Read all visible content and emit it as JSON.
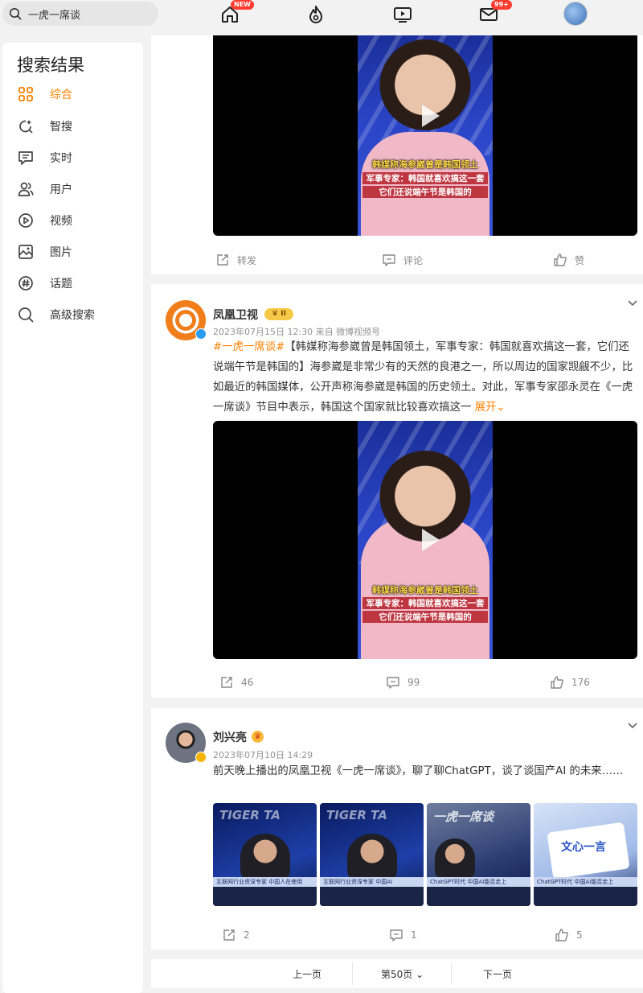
{
  "search": {
    "query": "一虎一席谈"
  },
  "topnav": {
    "items": [
      {
        "name": "home",
        "badge": "NEW"
      },
      {
        "name": "hot",
        "badge": ""
      },
      {
        "name": "video",
        "badge": ""
      },
      {
        "name": "message",
        "badge": "99+"
      }
    ]
  },
  "sidebar": {
    "title": "搜索结果",
    "items": [
      {
        "label": "综合",
        "icon": "grid-icon",
        "active": true
      },
      {
        "label": "智搜",
        "icon": "smart-search-icon"
      },
      {
        "label": "实时",
        "icon": "realtime-icon"
      },
      {
        "label": "用户",
        "icon": "users-icon"
      },
      {
        "label": "视频",
        "icon": "video-icon"
      },
      {
        "label": "图片",
        "icon": "image-icon"
      },
      {
        "label": "话题",
        "icon": "topic-icon"
      },
      {
        "label": "高级搜索",
        "icon": "advanced-search-icon"
      }
    ]
  },
  "video": {
    "caption_title": "韩媒称海参崴曾是韩国领土",
    "caption_line1": "军事专家：韩国就喜欢搞这一套",
    "caption_line2": "它们还说端午节是韩国的"
  },
  "post0": {
    "actions": {
      "repost": "转发",
      "comment": "评论",
      "like": "赞"
    }
  },
  "post1": {
    "username": "凤凰卫视",
    "level_badge": "II",
    "meta": "2023年07月15日 12:30  来自 微博视频号",
    "hashtag": "#一虎一席谈#",
    "text": "【韩媒称海参崴曾是韩国领土，军事专家：韩国就喜欢搞这一套，它们还说端午节是韩国的】海参崴是非常少有的天然的良港之一，所以周边的国家觊觎不少，比如最近的韩国媒体，公开声称海参崴是韩国的历史领土。对此，军事专家邵永灵在《一虎一席谈》节目中表示，韩国这个国家就比较喜欢搞这一",
    "more": "展开",
    "actions": {
      "repost": "46",
      "comment": "99",
      "like": "176"
    }
  },
  "post2": {
    "username": "刘兴亮",
    "meta": "2023年07月10日 14:29",
    "text": "前天晚上播出的凤凰卫视《一虎一席谈》，聊了聊ChatGPT，谈了谈国产AI 的未来……",
    "thumbs": [
      {
        "title": "TIGER TA",
        "ticker": "互联网行业资深专家 中国人在使用"
      },
      {
        "title": "TIGER TA",
        "ticker": "互联网行业资深专家 中国AI"
      },
      {
        "title": "一虎一席谈",
        "ticker": "ChatGPT时代 中国AI能否走上"
      },
      {
        "title": "文心一言",
        "ticker": "ChatGPT时代 中国AI能否走上"
      }
    ],
    "actions": {
      "repost": "2",
      "comment": "1",
      "like": "5"
    }
  },
  "pager": {
    "prev": "上一页",
    "current": "第50页",
    "next": "下一页"
  },
  "colors": {
    "accent": "#ff8200",
    "badge": "#ff3b30"
  }
}
